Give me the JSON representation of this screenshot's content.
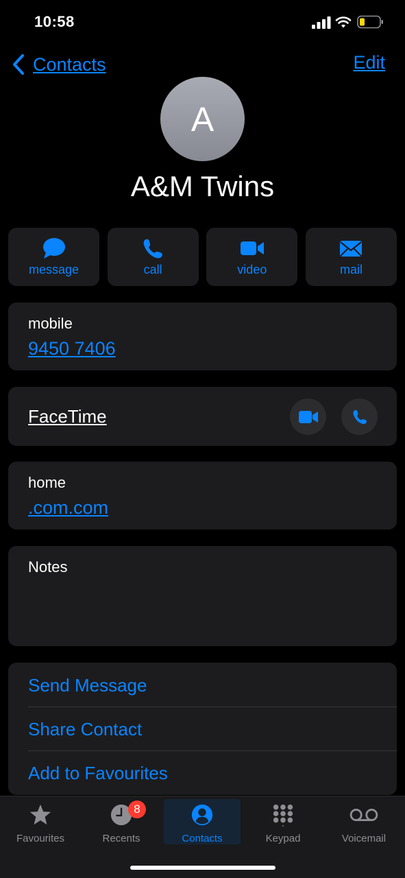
{
  "status_bar": {
    "time": "10:58"
  },
  "nav": {
    "back_label": "Contacts",
    "edit_label": "Edit"
  },
  "contact": {
    "initial": "A",
    "name": "A&M Twins"
  },
  "actions": [
    {
      "label": "message",
      "icon": "message-icon"
    },
    {
      "label": "call",
      "icon": "phone-icon"
    },
    {
      "label": "video",
      "icon": "video-icon"
    },
    {
      "label": "mail",
      "icon": "mail-icon"
    }
  ],
  "phone": {
    "label": "mobile",
    "value": "9450 7406"
  },
  "facetime": {
    "label": "FaceTime"
  },
  "email": {
    "label": "home",
    "value": ".com.com"
  },
  "notes": {
    "label": "Notes"
  },
  "links": {
    "send_message": "Send Message",
    "share_contact": "Share Contact",
    "add_favourites": "Add to Favourites"
  },
  "tabs": [
    {
      "label": "Favourites",
      "icon": "star-icon"
    },
    {
      "label": "Recents",
      "icon": "clock-icon",
      "badge": "8"
    },
    {
      "label": "Contacts",
      "icon": "person-icon",
      "active": true
    },
    {
      "label": "Keypad",
      "icon": "keypad-icon"
    },
    {
      "label": "Voicemail",
      "icon": "voicemail-icon"
    }
  ],
  "colors": {
    "accent": "#0a84ff",
    "card": "#1c1c1e",
    "background": "#000000",
    "badge": "#ff3b30"
  }
}
